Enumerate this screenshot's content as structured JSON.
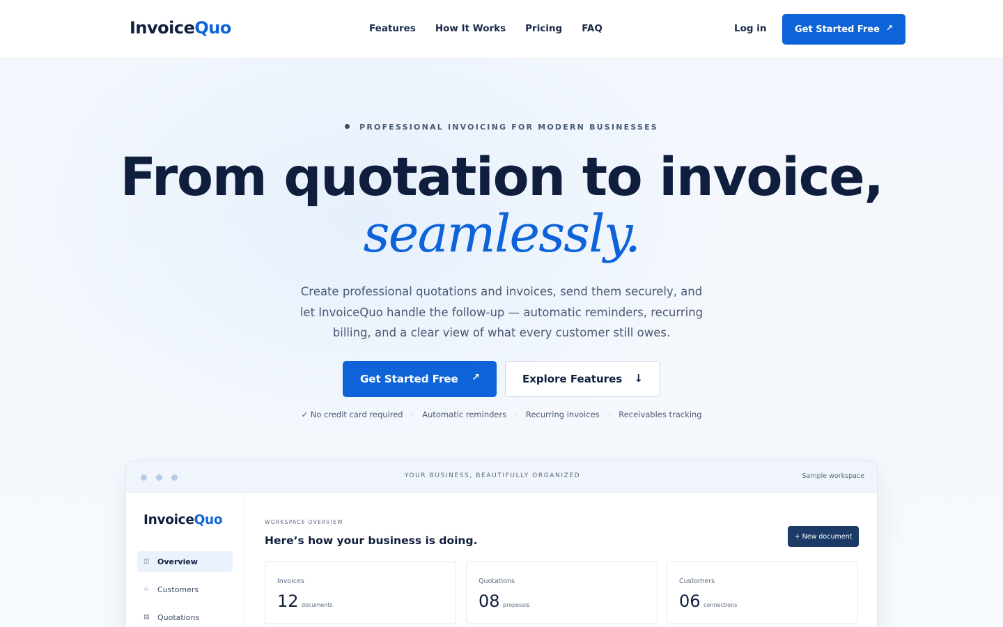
{
  "header": {
    "logo": {
      "main": "Invoice",
      "accent": "Quo"
    },
    "nav": [
      "Features",
      "How It Works",
      "Pricing",
      "FAQ"
    ],
    "login": "Log in",
    "cta": "Get Started Free",
    "cta_icon": "arrow-up-right-icon"
  },
  "hero": {
    "eyebrow": "PROFESSIONAL INVOICING FOR MODERN BUSINESSES",
    "headline": "From quotation to invoice,",
    "headline_accent": "seamlessly.",
    "lede": "Create professional quotations and invoices, send them securely, and let InvoiceQuo handle the follow-up — automatic reminders, recurring billing, and a clear view of what every customer still owes.",
    "primary_cta": "Get Started Free",
    "secondary_cta": "Explore Features",
    "perks": [
      "✓ No credit card required",
      "Automatic reminders",
      "Recurring invoices",
      "Receivables tracking"
    ]
  },
  "preview": {
    "window_title": "YOUR BUSINESS, BEAUTIFULLY ORGANIZED",
    "window_right": "Sample workspace",
    "sidebar": {
      "logo": {
        "main": "Invoice",
        "accent": "Quo"
      },
      "items": [
        {
          "label": "Overview",
          "icon": "◫"
        },
        {
          "label": "Customers",
          "icon": "♧"
        },
        {
          "label": "Quotations",
          "icon": "▤"
        }
      ]
    },
    "main": {
      "label": "WORKSPACE OVERVIEW",
      "title": "Here’s how your business is doing.",
      "new_button": "+ New document",
      "stats": [
        {
          "label": "Invoices",
          "value": "12",
          "unit": "documents"
        },
        {
          "label": "Quotations",
          "value": "08",
          "unit": "proposals"
        },
        {
          "label": "Customers",
          "value": "06",
          "unit": "connections"
        }
      ]
    }
  },
  "colors": {
    "brand": "#0e63d8",
    "ink": "#0f1e3d",
    "navy_button": "#1b3a66",
    "page_bg": "#f4f8fd"
  }
}
